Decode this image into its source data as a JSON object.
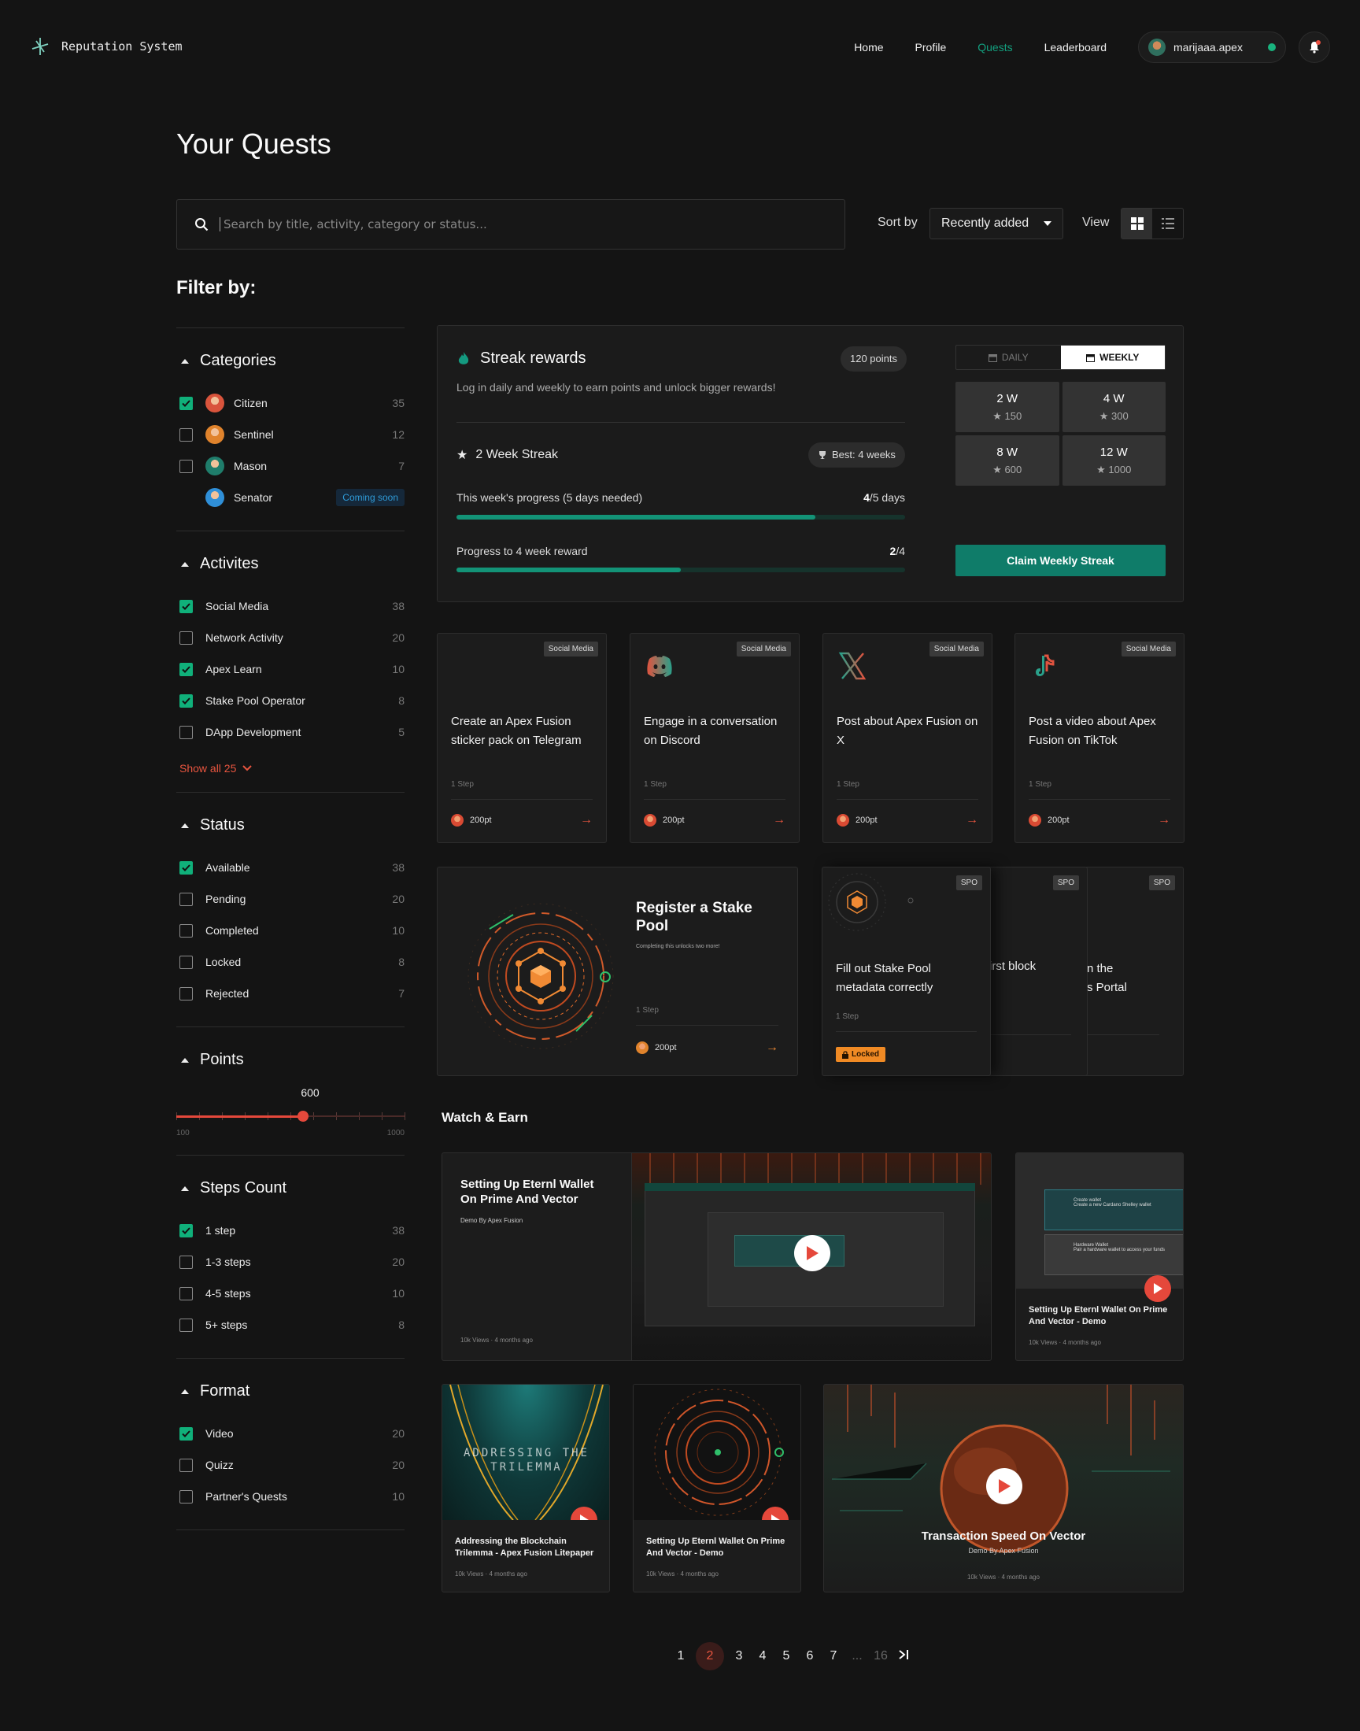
{
  "app": {
    "name": "Reputation System"
  },
  "nav": {
    "items": [
      {
        "label": "Home"
      },
      {
        "label": "Profile"
      },
      {
        "label": "Quests"
      },
      {
        "label": "Leaderboard"
      }
    ],
    "active": "Quests",
    "user": {
      "name": "marijaaa.apex",
      "status_color": "#19b37e"
    }
  },
  "page": {
    "title": "Your Quests",
    "search_placeholder": "Search by title, activity, category or status...",
    "sort_label": "Sort by",
    "sort_value": "Recently added",
    "view_label": "View",
    "view_mode": "grid",
    "filter_title": "Filter by:"
  },
  "filters": {
    "categories": {
      "title": "Categories",
      "items": [
        {
          "label": "Citizen",
          "count": "35",
          "checked": true,
          "color": "#d9543c"
        },
        {
          "label": "Sentinel",
          "count": "12",
          "checked": false,
          "color": "#e0832c"
        },
        {
          "label": "Mason",
          "count": "7",
          "checked": false,
          "color": "#1f7d6b"
        },
        {
          "label": "Senator",
          "badge": "Coming soon",
          "color": "#2f8fd8"
        }
      ]
    },
    "activities": {
      "title": "Activites",
      "items": [
        {
          "label": "Social Media",
          "count": "38",
          "checked": true
        },
        {
          "label": "Network Activity",
          "count": "20",
          "checked": false
        },
        {
          "label": "Apex Learn",
          "count": "10",
          "checked": true
        },
        {
          "label": "Stake Pool Operator",
          "count": "8",
          "checked": true
        },
        {
          "label": "DApp Development",
          "count": "5",
          "checked": false
        }
      ],
      "show_all": "Show all 25"
    },
    "status": {
      "title": "Status",
      "items": [
        {
          "label": "Available",
          "count": "38",
          "checked": true
        },
        {
          "label": "Pending",
          "count": "20",
          "checked": false
        },
        {
          "label": "Completed",
          "count": "10",
          "checked": false
        },
        {
          "label": "Locked",
          "count": "8",
          "checked": false
        },
        {
          "label": "Rejected",
          "count": "7",
          "checked": false
        }
      ]
    },
    "points": {
      "title": "Points",
      "value": "600",
      "min": "100",
      "max": "1000"
    },
    "steps": {
      "title": "Steps Count",
      "items": [
        {
          "label": "1 step",
          "count": "38",
          "checked": true
        },
        {
          "label": "1-3 steps",
          "count": "20",
          "checked": false
        },
        {
          "label": "4-5 steps",
          "count": "10",
          "checked": false
        },
        {
          "label": "5+ steps",
          "count": "8",
          "checked": false
        }
      ]
    },
    "format": {
      "title": "Format",
      "items": [
        {
          "label": "Video",
          "count": "20",
          "checked": true
        },
        {
          "label": "Quizz",
          "count": "20",
          "checked": false
        },
        {
          "label": "Partner's Quests",
          "count": "10",
          "checked": false
        }
      ]
    }
  },
  "streak": {
    "title": "Streak rewards",
    "points": "120 points",
    "description": "Log in daily and weekly to earn points and unlock bigger rewards!",
    "current": "2 Week Streak",
    "best": "Best: 4 weeks",
    "week_progress": {
      "label": "This week's progress (5 days needed)",
      "done": "4",
      "total": "/5 days",
      "fraction": 0.8
    },
    "reward_progress": {
      "label": "Progress to 4 week reward",
      "done": "2",
      "total": "/4",
      "fraction": 0.5
    },
    "tabs": [
      {
        "label": "DAILY"
      },
      {
        "label": "WEEKLY"
      }
    ],
    "active_tab": "WEEKLY",
    "rewards": [
      {
        "weeks": "2 W",
        "points": "150"
      },
      {
        "weeks": "4 W",
        "points": "300"
      },
      {
        "weeks": "8 W",
        "points": "600"
      },
      {
        "weeks": "12 W",
        "points": "1000"
      }
    ],
    "claim_label": "Claim Weekly Streak"
  },
  "quests": [
    {
      "tag": "Social Media",
      "title": "Create an Apex Fusion sticker pack on Telegram",
      "steps": "1 Step",
      "points": "200pt",
      "icon": "telegram-icon"
    },
    {
      "tag": "Social Media",
      "title": "Engage in a conversation on Discord",
      "steps": "1 Step",
      "points": "200pt",
      "icon": "discord-icon"
    },
    {
      "tag": "Social Media",
      "title": "Post about Apex Fusion on X",
      "steps": "1 Step",
      "points": "200pt",
      "icon": "x-icon"
    },
    {
      "tag": "Social Media",
      "title": "Post a video about Apex Fusion on TikTok",
      "steps": "1 Step",
      "points": "200pt",
      "icon": "tiktok-icon"
    }
  ],
  "spo": {
    "main": {
      "title": "Register a Stake Pool",
      "subtitle": "Completing this unlocks two more!",
      "steps": "1 Step",
      "points": "200pt"
    },
    "stack": [
      {
        "tag": "SPO",
        "title": "Fill out Stake Pool metadata correctly",
        "steps": "1 Step",
        "status": "Locked"
      },
      {
        "tag": "SPO",
        "title": "irst block"
      },
      {
        "tag": "SPO",
        "title_line1": "n the",
        "title_line2": "s Portal"
      }
    ]
  },
  "watch": {
    "title": "Watch & Earn",
    "videos": [
      {
        "title": "Setting Up Eternl Wallet On Prime And Vector",
        "subtitle": "Demo By Apex Fusion",
        "views": "10k Views",
        "age": "4 months ago"
      },
      {
        "title": "Setting Up Eternl Wallet On Prime And Vector - Demo",
        "views": "10k Views",
        "age": "4 months ago",
        "thumb_line1": "Create wallet",
        "thumb_line2": "Create a new Cardano Shelley wallet",
        "thumb_line3": "Hardware Wallet",
        "thumb_line4": "Pair a hardware wallet to access your funds"
      },
      {
        "title": "Addressing the Blockchain Trilemma - Apex Fusion Litepaper",
        "views": "10k Views",
        "age": "4 months ago",
        "thumb_text1": "ADDRESSING THE",
        "thumb_text2": "TRILEMMA"
      },
      {
        "title": "Setting Up Eternl Wallet On Prime And Vector - Demo",
        "views": "10k Views",
        "age": "4 months ago"
      },
      {
        "title": "Transaction Speed On Vector",
        "subtitle": "Demo By Apex Fusion",
        "views": "10k Views",
        "age": "4 months ago"
      }
    ]
  },
  "pagination": {
    "pages": [
      "1",
      "2",
      "3",
      "4",
      "5",
      "6",
      "7"
    ],
    "current": "2",
    "ellipsis": "...",
    "last": "16"
  },
  "colors": {
    "accent": "#13a07f",
    "danger": "#e5483b",
    "background": "#141414"
  }
}
